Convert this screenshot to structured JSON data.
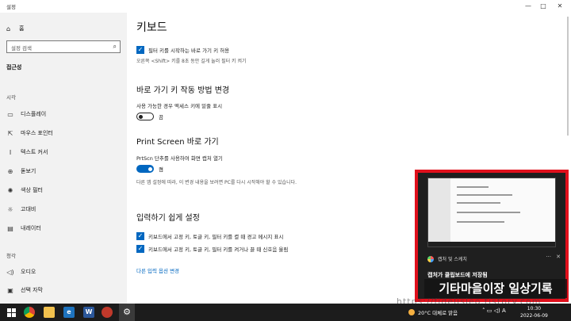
{
  "window": {
    "title": "설정",
    "controls": {
      "minimize": "—",
      "maximize": "□",
      "close": "✕"
    }
  },
  "sidebar": {
    "home_label": "홈",
    "search_placeholder": "설정 검색",
    "group_title": "접근성",
    "section_vision": "시각",
    "section_hearing": "청각",
    "items": [
      {
        "label": "디스플레이",
        "icon": "monitor-icon"
      },
      {
        "label": "마우스 포인터",
        "icon": "pointer-icon"
      },
      {
        "label": "텍스트 커서",
        "icon": "text-cursor-icon"
      },
      {
        "label": "돋보기",
        "icon": "magnifier-icon"
      },
      {
        "label": "색상 필터",
        "icon": "color-filter-icon"
      },
      {
        "label": "고대비",
        "icon": "high-contrast-icon"
      },
      {
        "label": "내레이터",
        "icon": "narrator-icon"
      },
      {
        "label": "오디오",
        "icon": "speaker-icon"
      },
      {
        "label": "선택 자막",
        "icon": "captions-icon"
      }
    ]
  },
  "main": {
    "title": "키보드",
    "filter_keys_shortcut": "필터 키를 시작하는 바로 가기 키 허용",
    "filter_keys_hint": "오른쪽 <Shift> 키를 8초 동안 길게 눌러 필터 키 켜기",
    "shortcut_section": "바로 가기 키 작동 방법 변경",
    "underline_label": "사용 가능한 경우 액세스 키에 밑줄 표시",
    "underline_toggle": "끔",
    "printscreen_section": "Print Screen 바로 가기",
    "printscreen_label": "PrtScn 단추를 사용하여 화면 캡처 열기",
    "printscreen_toggle": "켬",
    "printscreen_hint": "다른 앱 설정에 따라, 이 변경 내용을 보려면 PC를 다시 시작해야 할 수 있습니다.",
    "typing_section": "입력하기 쉽게 설정",
    "warning_checkbox": "키보드에서 고정 키, 토글 키, 필터 키를 켤 때 경고 메시지 표시",
    "sound_checkbox": "키보드에서 고정 키, 토글 키, 필터 키를 켜거나 끌 때 신호음 울림",
    "other_link": "다른 입력 옵션 변경"
  },
  "notification": {
    "app_name": "캡처 및 스케치",
    "message": "캡처가 클립보드에 저장됨",
    "more": "···",
    "close": "✕"
  },
  "watermark": {
    "title": "기타마을이장 일상기록",
    "url": "https://fidelisleo.tistory.com"
  },
  "taskbar": {
    "weather": "20°C 대체로 맑음",
    "tray_lang": "A",
    "time": "10:30",
    "date": "2022-06-09"
  },
  "colors": {
    "accent": "#0067c0",
    "highlight_border": "#e0101c",
    "taskbar": "#1c1c1c"
  }
}
